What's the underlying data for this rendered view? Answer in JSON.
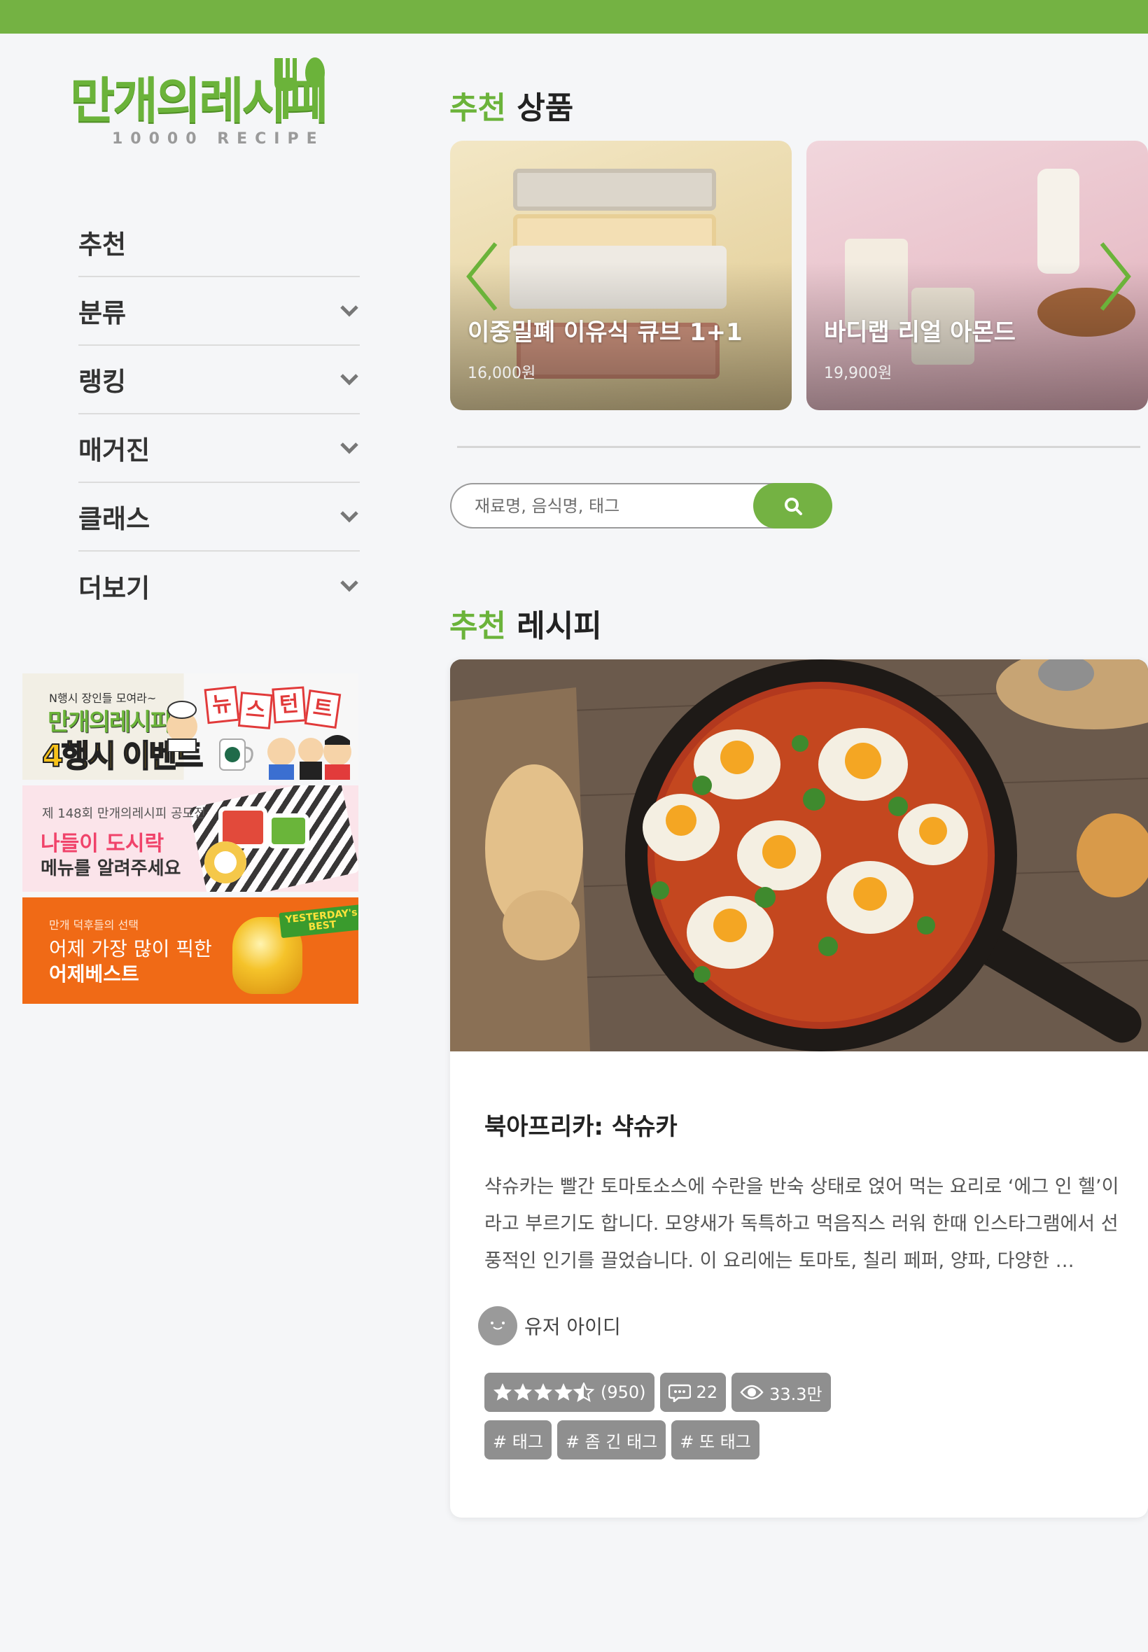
{
  "brand": {
    "name": "만개의레시피",
    "sub": "10000 RECIPE",
    "color": "#74b243"
  },
  "nav": {
    "items": [
      {
        "label": "추천",
        "icon": ""
      },
      {
        "label": "분류",
        "icon": "chevron-down-icon"
      },
      {
        "label": "랭킹",
        "icon": "chevron-down-icon"
      },
      {
        "label": "매거진",
        "icon": "chevron-down-icon"
      },
      {
        "label": "클래스",
        "icon": "chevron-down-icon"
      },
      {
        "label": "더보기",
        "icon": "chevron-down-icon"
      }
    ]
  },
  "banners": {
    "b1": {
      "small": "N행시 장인들 모여라~",
      "title": "만개의레시피",
      "title2": "4행시 이벤트",
      "news": [
        "뉴",
        "스",
        "턴",
        "트"
      ]
    },
    "b2": {
      "small": "제 148회 만개의레시피 공모전",
      "title": "나들이 도시락",
      "sub": "메뉴를 알려주세요"
    },
    "b3": {
      "small": "만개 덕후들의 선택",
      "title": "어제 가장 많이 픽한",
      "title2": "어제베스트",
      "badge1": "YESTERDAY's",
      "badge2": "BEST"
    }
  },
  "products_section": {
    "accent": "추천",
    "title": "상품"
  },
  "products": [
    {
      "name": "이중밀폐 이유식 큐브 1+1",
      "price": "16,000원"
    },
    {
      "name": "바디랩 리얼 아몬드",
      "price": "19,900원"
    }
  ],
  "search": {
    "placeholder": "재료명, 음식명, 태그",
    "value": ""
  },
  "recipes_section": {
    "accent": "추천",
    "title": "레시피"
  },
  "recipe": {
    "title": "북아프리카: 샥슈카",
    "description": "샥슈카는 빨간 토마토소스에 수란을 반숙 상태로 얹어 먹는 요리로 ‘에그 인 헬’이라고 부르기도 합니다. 모양새가 독특하고 먹음직스 러워 한때 인스타그램에서 선풍적인 인기를 끌었습니다. 이 요리에는 토마토, 칠리 페퍼, 양파, 다양한 …",
    "author": "유저 아이디",
    "rating_count": "(950)",
    "rating": 4.5,
    "comments": "22",
    "views": "33.3만",
    "tags": [
      "# 태그",
      "# 좀 긴 태그",
      "# 또 태그"
    ]
  }
}
